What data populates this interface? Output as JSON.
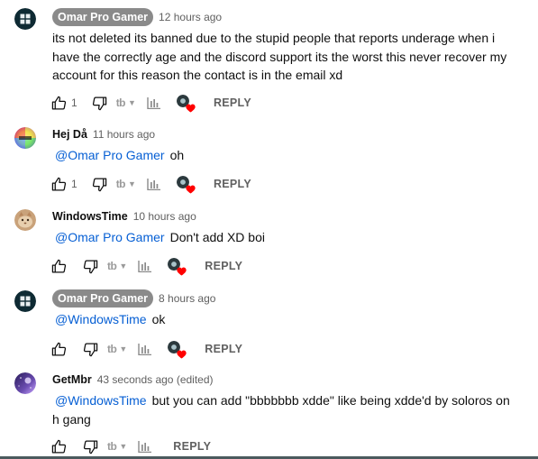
{
  "colors": {
    "mention": "#065fd4",
    "author_chip_bg": "#8a8a8a",
    "heart": "#ff0000",
    "meta_text": "#606060"
  },
  "icons": {
    "like": "thumbs-up-icon",
    "dislike": "thumbs-down-icon",
    "tb": "tb-extension-icon",
    "stats": "bar-chart-icon",
    "heart": "creator-heart-icon"
  },
  "comments": [
    {
      "author": "Omar Pro Gamer",
      "owner_chip": true,
      "time": "12 hours ago",
      "mention": "",
      "text_lines": [
        "its not deleted its banned due to the stupid people that reports underage when i",
        "have the correctly age and the discord support its the worst this never recover my",
        "account for this reason the contact is in the email xd"
      ],
      "likes": "1",
      "reply_label": "REPLY"
    },
    {
      "author": "Hej Då",
      "owner_chip": false,
      "time": "11 hours ago",
      "mention": "@Omar Pro Gamer",
      "text_lines": [
        "oh"
      ],
      "likes": "1",
      "reply_label": "REPLY"
    },
    {
      "author": "WindowsTime",
      "owner_chip": false,
      "time": "10 hours ago",
      "mention": "@Omar Pro Gamer",
      "text_lines": [
        "Don't add XD boi"
      ],
      "likes": "",
      "reply_label": "REPLY"
    },
    {
      "author": "Omar Pro Gamer",
      "owner_chip": true,
      "time": "8 hours ago",
      "mention": "@WindowsTime",
      "text_lines": [
        "ok"
      ],
      "likes": "",
      "reply_label": "REPLY"
    },
    {
      "author": "GetMbr",
      "owner_chip": false,
      "time": "43 seconds ago (edited)",
      "mention": "@WindowsTime",
      "text_lines": [
        "but you can add \"bbbbbbb xdde\" like being xdde'd by soloros on",
        "h gang"
      ],
      "likes": "",
      "reply_label": "REPLY"
    }
  ]
}
